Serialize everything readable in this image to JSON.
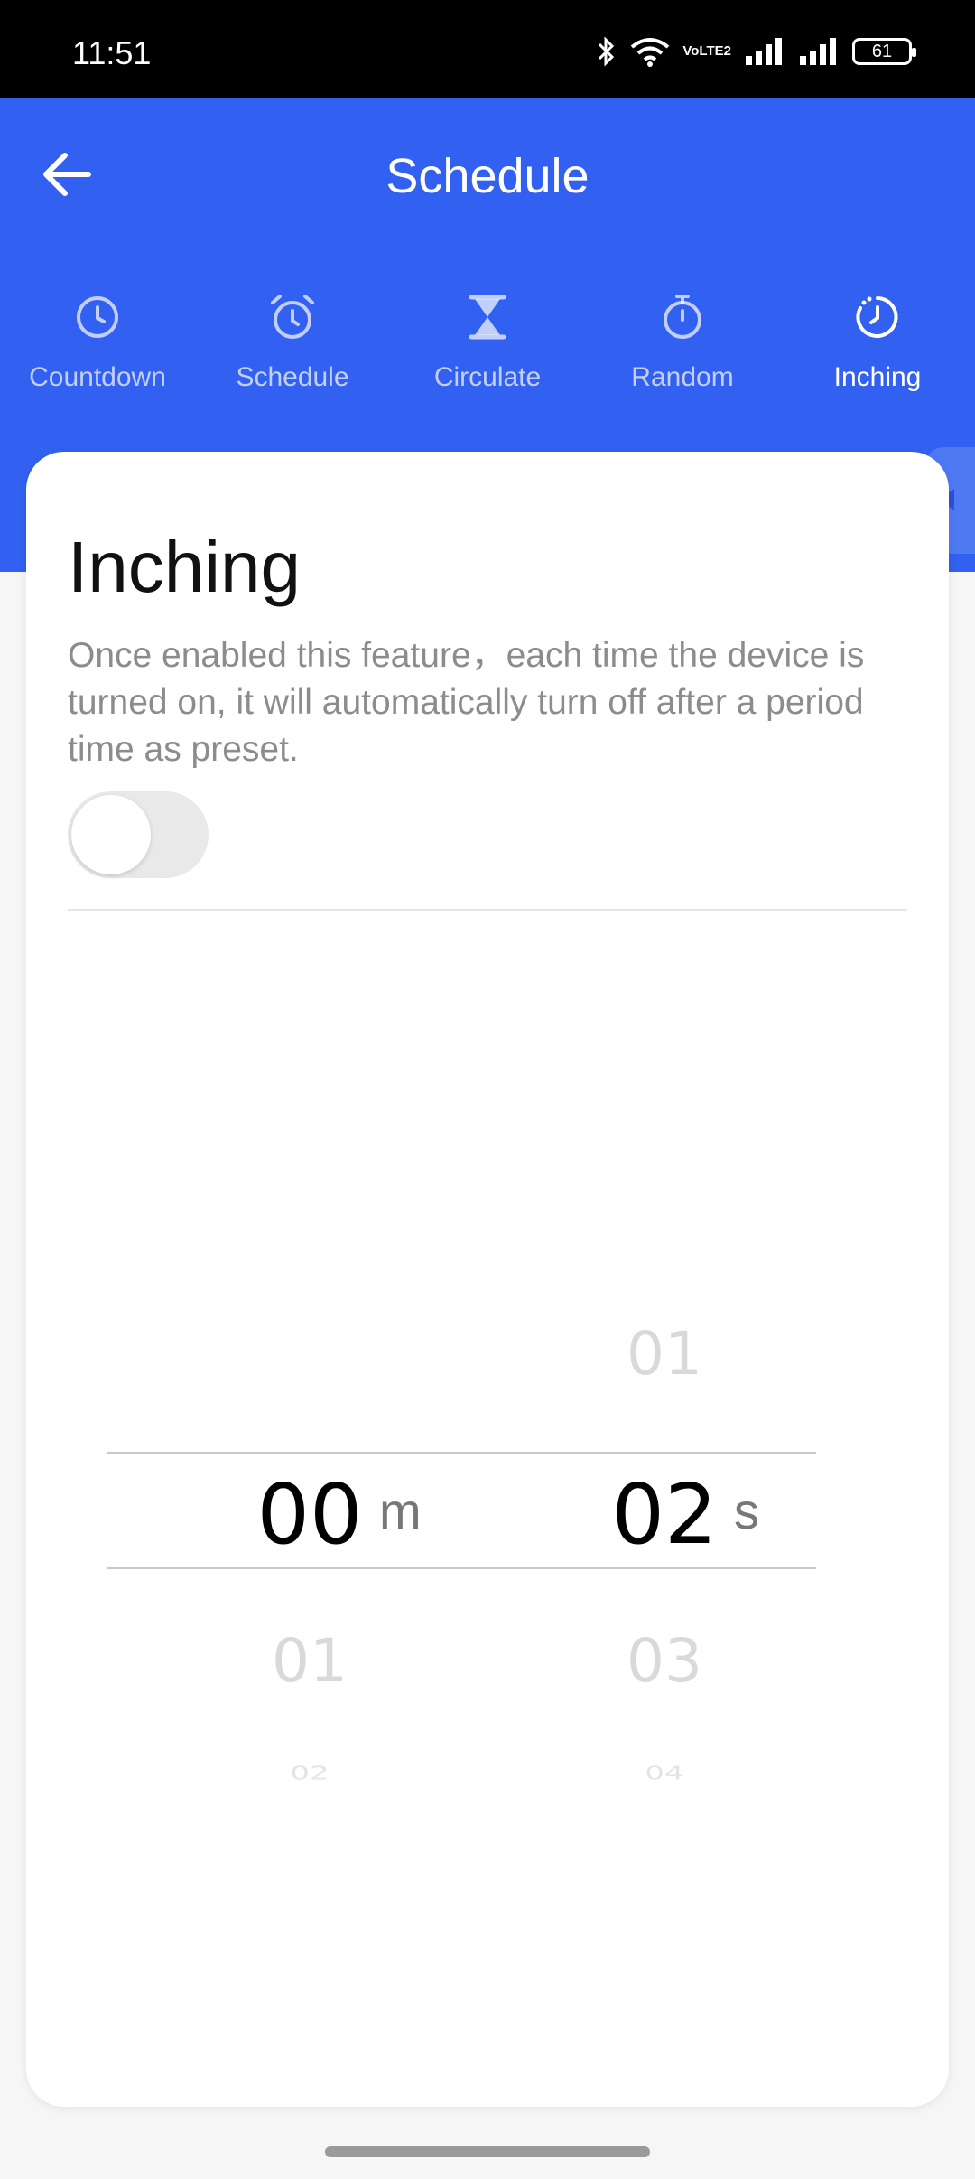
{
  "status_bar": {
    "time": "11:51",
    "battery_level": "61",
    "network_label": "VoLTE2"
  },
  "header": {
    "title": "Schedule",
    "background_color": "#3260f0"
  },
  "tabs": [
    {
      "label": "Countdown",
      "icon": "clock-icon",
      "active": false
    },
    {
      "label": "Schedule",
      "icon": "alarm-clock-icon",
      "active": false
    },
    {
      "label": "Circulate",
      "icon": "hourglass-icon",
      "active": false
    },
    {
      "label": "Random",
      "icon": "stopwatch-icon",
      "active": false
    },
    {
      "label": "Inching",
      "icon": "dotted-clock-icon",
      "active": true
    }
  ],
  "inching": {
    "title": "Inching",
    "description": "Once enabled this feature，each time the device is turned on, it will automatically turn off after a period time as preset.",
    "enabled": false
  },
  "picker": {
    "minutes": {
      "above": "",
      "selected": "00",
      "below1": "01",
      "below2": "02",
      "unit": "m"
    },
    "seconds": {
      "above": "01",
      "selected": "02",
      "below1": "03",
      "below2": "04",
      "unit": "s"
    }
  }
}
